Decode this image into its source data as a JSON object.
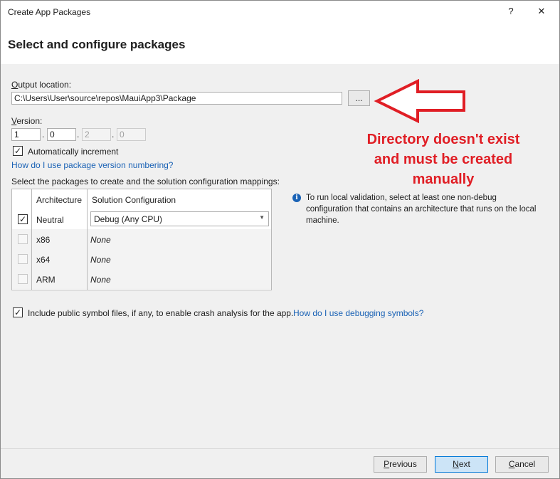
{
  "window": {
    "title": "Create App Packages",
    "help_glyph": "?",
    "close_glyph": "✕"
  },
  "header": {
    "heading": "Select and configure packages"
  },
  "output": {
    "label": "Output location:",
    "path": "C:\\Users\\User\\source\\repos\\MauiApp3\\Package",
    "browse_label": "..."
  },
  "version": {
    "label": "Version:",
    "major": "1",
    "minor": "0",
    "build": "2",
    "revision": "0",
    "separator": ".",
    "auto_increment_label": "Automatically increment",
    "auto_increment_checked": true,
    "help_link": "How do I use package version numbering?"
  },
  "packages": {
    "label": "Select the packages to create and the solution configuration mappings:",
    "columns": [
      "Architecture",
      "Solution Configuration"
    ],
    "rows": [
      {
        "checked": true,
        "arch": "Neutral",
        "config": "Debug (Any CPU)"
      },
      {
        "checked": false,
        "arch": "x86",
        "config": "None"
      },
      {
        "checked": false,
        "arch": "x64",
        "config": "None"
      },
      {
        "checked": false,
        "arch": "ARM",
        "config": "None"
      }
    ]
  },
  "info": {
    "icon": "i",
    "text": "To run local validation, select at least one non-debug configuration that contains an architecture that runs on the local machine."
  },
  "symbols": {
    "checked": true,
    "label": "Include public symbol files, if any, to enable crash analysis for the app.",
    "link": "How do I use debugging symbols?"
  },
  "annotation": {
    "lines": [
      "Directory doesn't exist",
      "and must be created",
      "manually"
    ],
    "color": "#e01e25"
  },
  "footer": {
    "previous": "Previous",
    "next": "Next",
    "cancel": "Cancel"
  },
  "colors": {
    "link": "#1a62b5",
    "primary_button": "#cce4f7",
    "primary_border": "#0078d7"
  }
}
